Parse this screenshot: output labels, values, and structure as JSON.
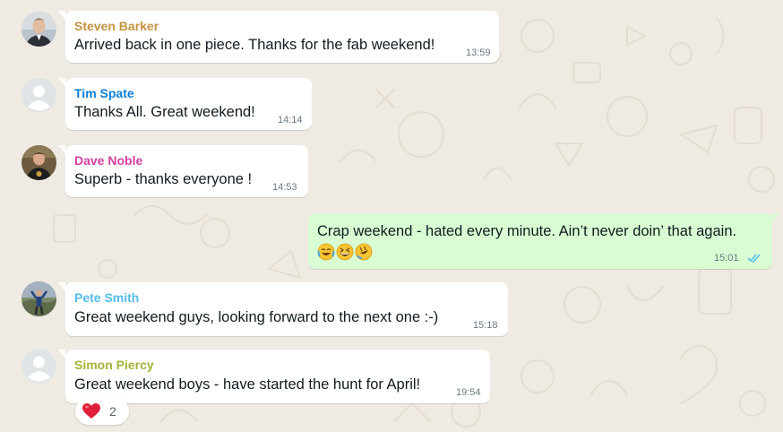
{
  "messages": [
    {
      "sender": "Steven Barker",
      "sender_color": "#c4933f",
      "text": "Arrived back in one piece. Thanks for the fab weekend!",
      "time": "13:59"
    },
    {
      "sender": "Tim Spate",
      "sender_color": "#0b7dd8",
      "text": "Thanks All.  Great weekend!",
      "time": "14:14"
    },
    {
      "sender": "Dave Noble",
      "sender_color": "#d63ea0",
      "text": "Superb - thanks everyone !",
      "time": "14:53"
    },
    {
      "sender": "",
      "text": "Crap weekend - hated every minute. Ain’t never doin’ that again.",
      "emojis": [
        "face-with-tears-of-joy",
        "grinning-squinting-face",
        "rolling-on-floor-laughing"
      ],
      "time": "15:01",
      "status": "read-double-tick"
    },
    {
      "sender": "Pete Smith",
      "sender_color": "#53bdeb",
      "text": "Great weekend guys, looking forward to the next one :-)",
      "time": "15:18"
    },
    {
      "sender": "Simon Piercy",
      "sender_color": "#a5b337",
      "text": "Great weekend boys - have started the hunt for April!",
      "time": "19:54",
      "reaction": {
        "icon": "red-heart",
        "count": "2"
      }
    }
  ],
  "colors": {
    "background": "#efeae2",
    "incoming_bubble": "#ffffff",
    "outgoing_bubble": "#d9fdd3",
    "read_tick": "#53bdeb"
  }
}
